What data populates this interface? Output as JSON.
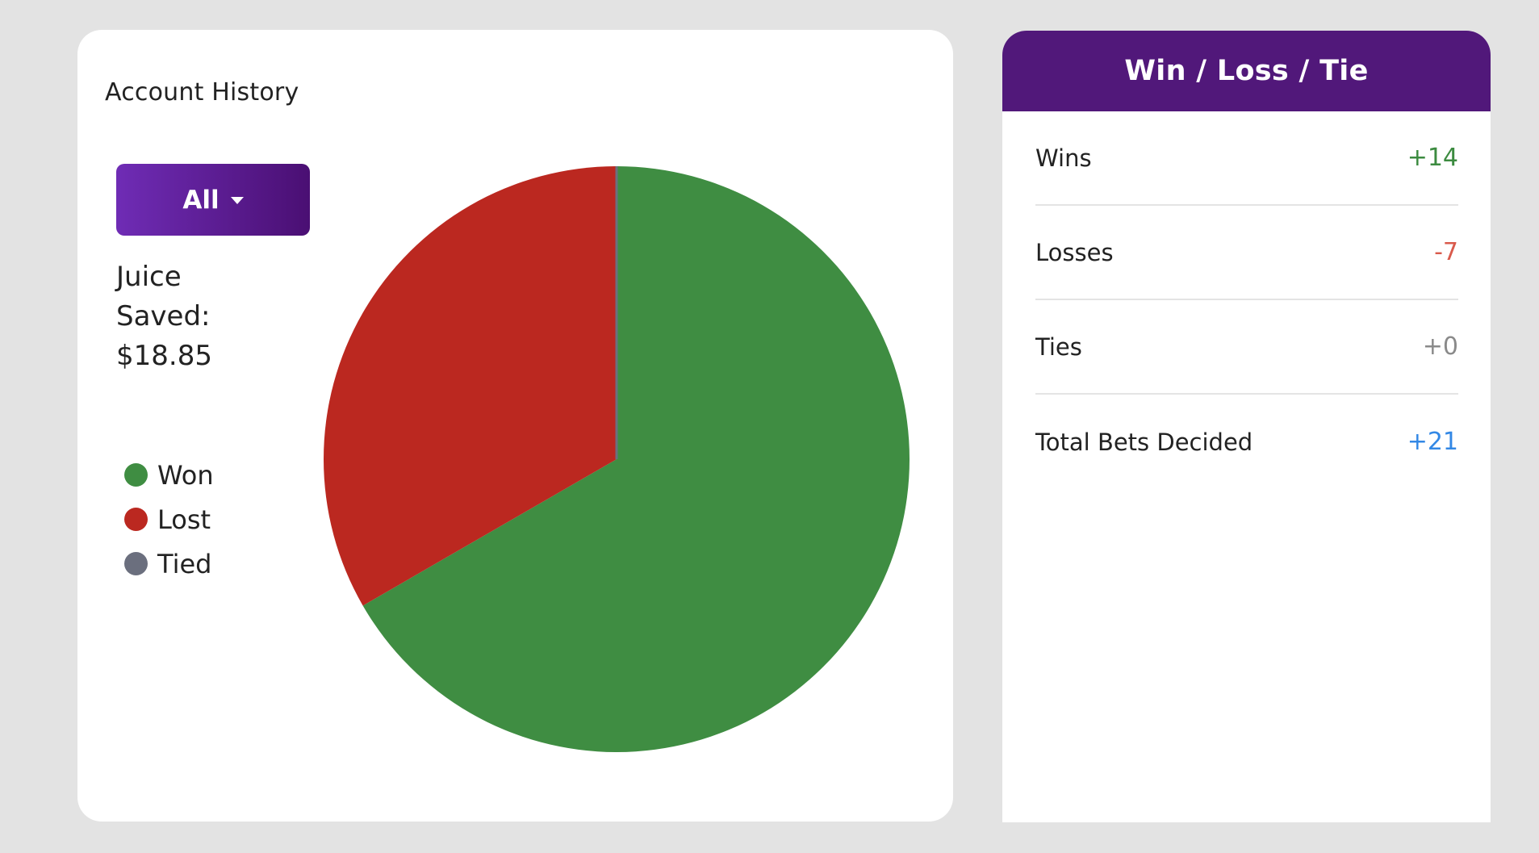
{
  "account_history": {
    "title": "Account History",
    "filter": {
      "selected": "All"
    },
    "juice": {
      "line1": "Juice",
      "line2": "Saved:",
      "amount": "$18.85"
    },
    "legend": [
      {
        "label": "Won",
        "color": "#3f8d42"
      },
      {
        "label": "Lost",
        "color": "#bb2820"
      },
      {
        "label": "Tied",
        "color": "#6b6f7e"
      }
    ]
  },
  "chart_data": {
    "type": "pie",
    "categories": [
      "Won",
      "Lost",
      "Tied"
    ],
    "values": [
      14,
      7,
      0
    ],
    "colors": [
      "#3f8d42",
      "#bb2820",
      "#6b6f7e"
    ],
    "title": ""
  },
  "summary": {
    "title": "Win / Loss / Tie",
    "rows": [
      {
        "label": "Wins",
        "value": "+14",
        "color": "#3c8b40"
      },
      {
        "label": "Losses",
        "value": "-7",
        "color": "#d95a4c"
      },
      {
        "label": "Ties",
        "value": "+0",
        "color": "#8a8a8a"
      },
      {
        "label": "Total Bets Decided",
        "value": "+21",
        "color": "#3388e5"
      }
    ]
  },
  "theme": {
    "accent": "#51187a",
    "background": "#e3e3e3"
  }
}
